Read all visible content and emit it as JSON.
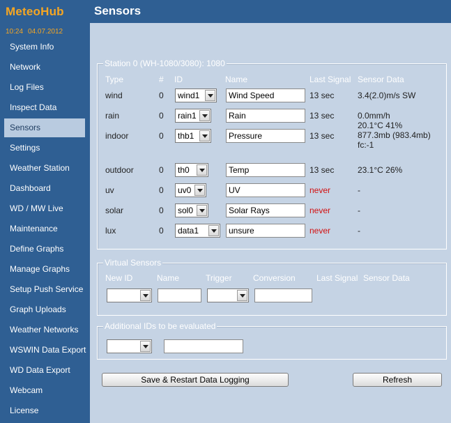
{
  "app": {
    "brand": "MeteoHub",
    "time": "10:24",
    "date": "04.07.2012"
  },
  "header": {
    "title": "Sensors"
  },
  "sidebar": {
    "items": [
      {
        "label": "System Info",
        "name": "system-info"
      },
      {
        "label": "Network",
        "name": "network"
      },
      {
        "label": "Log Files",
        "name": "log-files"
      },
      {
        "label": "Inspect Data",
        "name": "inspect-data"
      },
      {
        "label": "Sensors",
        "name": "sensors",
        "active": true
      },
      {
        "label": "Settings",
        "name": "settings"
      },
      {
        "label": "Weather Station",
        "name": "weather-station"
      },
      {
        "label": "Dashboard",
        "name": "dashboard"
      },
      {
        "label": "WD / MW Live",
        "name": "wd-mw-live"
      },
      {
        "label": "Maintenance",
        "name": "maintenance"
      },
      {
        "label": "Define Graphs",
        "name": "define-graphs"
      },
      {
        "label": "Manage Graphs",
        "name": "manage-graphs"
      },
      {
        "label": "Setup Push Service",
        "name": "setup-push-service"
      },
      {
        "label": "Graph Uploads",
        "name": "graph-uploads"
      },
      {
        "label": "Weather Networks",
        "name": "weather-networks"
      },
      {
        "label": "WSWIN Data Export",
        "name": "wswin-data-export"
      },
      {
        "label": "WD Data Export",
        "name": "wd-data-export"
      },
      {
        "label": "Webcam",
        "name": "webcam"
      },
      {
        "label": "License",
        "name": "license"
      }
    ]
  },
  "station": {
    "legend": "Station 0 (WH-1080/3080): 1080",
    "headers": {
      "type": "Type",
      "num": "#",
      "id": "ID",
      "name": "Name",
      "last_signal": "Last Signal",
      "sensor_data": "Sensor Data"
    },
    "rows": [
      {
        "type": "wind",
        "num": "0",
        "id": "wind1",
        "name": "Wind Speed",
        "last_signal": "13 sec",
        "never": false,
        "sensor_data": [
          "3.4(2.0)m/s SW"
        ]
      },
      {
        "type": "rain",
        "num": "0",
        "id": "rain1",
        "name": "Rain",
        "last_signal": "13 sec",
        "never": false,
        "sensor_data": [
          "0.0mm/h"
        ]
      },
      {
        "type": "indoor",
        "num": "0",
        "id": "thb1",
        "name": "Pressure",
        "last_signal": "13 sec",
        "never": false,
        "sensor_data": [
          "20.1°C 41%",
          "877.3mb (983.4mb)",
          "fc:-1"
        ]
      },
      {
        "type": "outdoor",
        "num": "0",
        "id": "th0",
        "name": "Temp",
        "last_signal": "13 sec",
        "never": false,
        "sensor_data": [
          "23.1°C 26%"
        ]
      },
      {
        "type": "uv",
        "num": "0",
        "id": "uv0",
        "name": "UV",
        "last_signal": "never",
        "never": true,
        "sensor_data": [
          "-"
        ]
      },
      {
        "type": "solar",
        "num": "0",
        "id": "sol0",
        "name": "Solar Rays",
        "last_signal": "never",
        "never": true,
        "sensor_data": [
          "-"
        ]
      },
      {
        "type": "lux",
        "num": "0",
        "id": "data1",
        "name": "unsure",
        "last_signal": "never",
        "never": true,
        "sensor_data": [
          "-"
        ]
      }
    ]
  },
  "virtual": {
    "legend": "Virtual Sensors",
    "headers": {
      "new_id": "New ID",
      "name": "Name",
      "trigger": "Trigger",
      "conversion": "Conversion",
      "last_signal": "Last Signal",
      "sensor_data": "Sensor Data"
    },
    "new_id_value": "",
    "name_value": "",
    "trigger_value": "",
    "conversion_value": ""
  },
  "additional": {
    "legend": "Additional IDs to be evaluated",
    "select_value": "",
    "text_value": ""
  },
  "buttons": {
    "save_restart": "Save & Restart Data Logging",
    "refresh": "Refresh"
  }
}
